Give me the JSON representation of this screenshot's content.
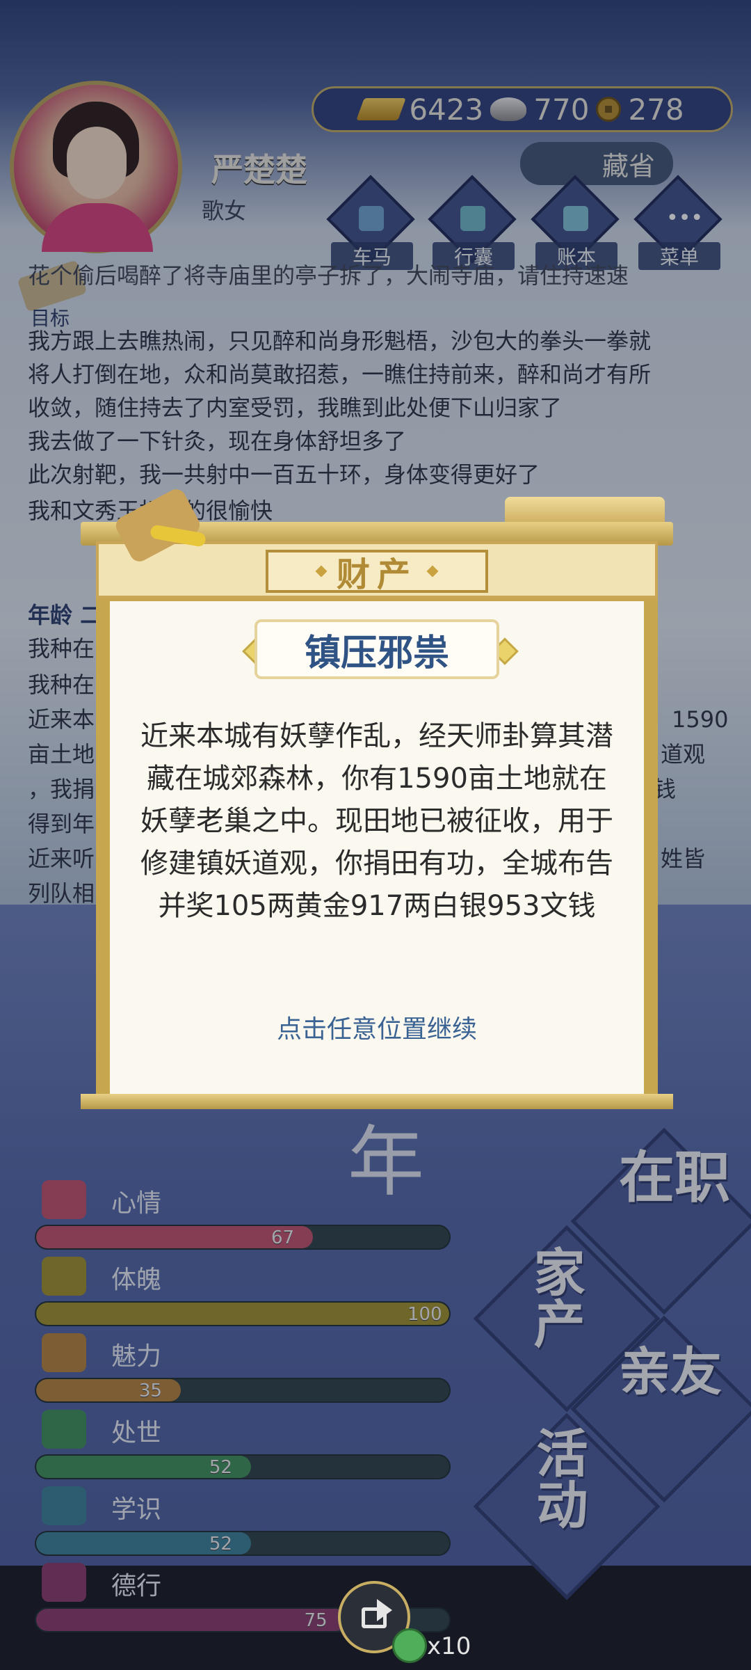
{
  "header": {
    "character_name": "严楚楚",
    "character_role": "歌女",
    "currency": {
      "gold": "6423",
      "silver": "770",
      "coin": "278"
    },
    "collect_label": "藏省",
    "nav": [
      {
        "label": "车马",
        "icon": "carriage-icon"
      },
      {
        "label": "行囊",
        "icon": "bag-icon"
      },
      {
        "label": "账本",
        "icon": "ledger-icon"
      },
      {
        "label": "菜单",
        "icon": "menu-icon"
      }
    ]
  },
  "goal_label": "目标",
  "log": [
    "花个偷后喝醉了将寺庙里的亭子拆了，大闹寺庙，请住持速速",
    "我方跟上去瞧热闹，只见醉和尚身形魁梧，沙包大的拳头一拳就",
    "将人打倒在地，众和尚莫敢招惹，一瞧住持前来，醉和尚才有所",
    "收敛，随住持去了内室受罚，我瞧到此处便下山归家了",
    "我去做了一下针灸，现在身体舒坦多了",
    "此次射靶，我一共射中一百五十环，身体变得更好了",
    "我和文秀玉相处的很愉快"
  ],
  "log2": {
    "heading": "年龄 二",
    "lines": [
      "我种在",
      "我种在",
      "近来本",
      "亩土地",
      "，我捐",
      "得到年",
      "近来听",
      "列队相"
    ],
    "right_lines": [
      "1590",
      "道观",
      "钱",
      "姓皆"
    ]
  },
  "stats": [
    {
      "name": "心情",
      "value": 67,
      "color": "#c0506a",
      "icon": "flower-icon"
    },
    {
      "name": "体魄",
      "value": 100,
      "color": "#a08f2a",
      "icon": "drum-icon"
    },
    {
      "name": "魅力",
      "value": 35,
      "color": "#b5813a",
      "icon": "mirror-icon"
    },
    {
      "name": "处世",
      "value": 52,
      "color": "#3f8f5a",
      "icon": "hand-icon"
    },
    {
      "name": "学识",
      "value": 52,
      "color": "#3b7f96",
      "icon": "books-icon"
    },
    {
      "name": "德行",
      "value": 75,
      "color": "#8a3a6a",
      "icon": "herb-icon"
    }
  ],
  "bg_year_char": "年",
  "actions": [
    "在职",
    "家产",
    "亲友",
    "活动"
  ],
  "share": {
    "count": "x10"
  },
  "modal": {
    "title": "财产",
    "subtitle": "镇压邪祟",
    "body": "近来本城有妖孽作乱，经天师卦算其潜藏在城郊森林，你有1590亩土地就在妖孽老巢之中。现田地已被征收，用于修建镇妖道观，你捐田有功，全城布告并奖105两黄金917两白银953文钱",
    "hint": "点击任意位置继续"
  }
}
